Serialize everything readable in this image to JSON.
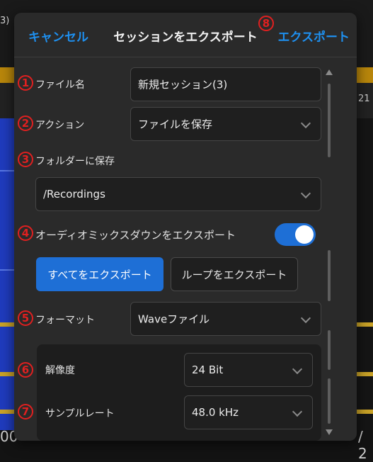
{
  "background": {
    "corner_text": "3)",
    "ruler_right_label": "21",
    "bottom_left_text": "00",
    "bottom_right_text": "/ 2"
  },
  "dialog": {
    "cancel_label": "キャンセル",
    "title": "セッションをエクスポート",
    "export_label": "エクスポート",
    "filename": {
      "label": "ファイル名",
      "value": "新規セッション(3)"
    },
    "action": {
      "label": "アクション",
      "value": "ファイルを保存"
    },
    "save_folder": {
      "label": "フォルダーに保存",
      "value": "/Recordings"
    },
    "mixdown": {
      "label": "オーディオミックスダウンをエクスポート",
      "enabled": true
    },
    "export_all_label": "すべてをエクスポート",
    "export_loop_label": "ループをエクスポート",
    "format": {
      "label": "フォーマット",
      "value": "Waveファイル"
    },
    "resolution": {
      "label": "解像度",
      "value": "24 Bit"
    },
    "sample_rate": {
      "label": "サンプルレート",
      "value": "48.0 kHz"
    }
  },
  "annotations": [
    "1",
    "2",
    "3",
    "4",
    "5",
    "6",
    "7",
    "8"
  ],
  "colors": {
    "accent": "#1e90f0",
    "toggle_on": "#1e6fd6",
    "annotation": "#e02020"
  }
}
